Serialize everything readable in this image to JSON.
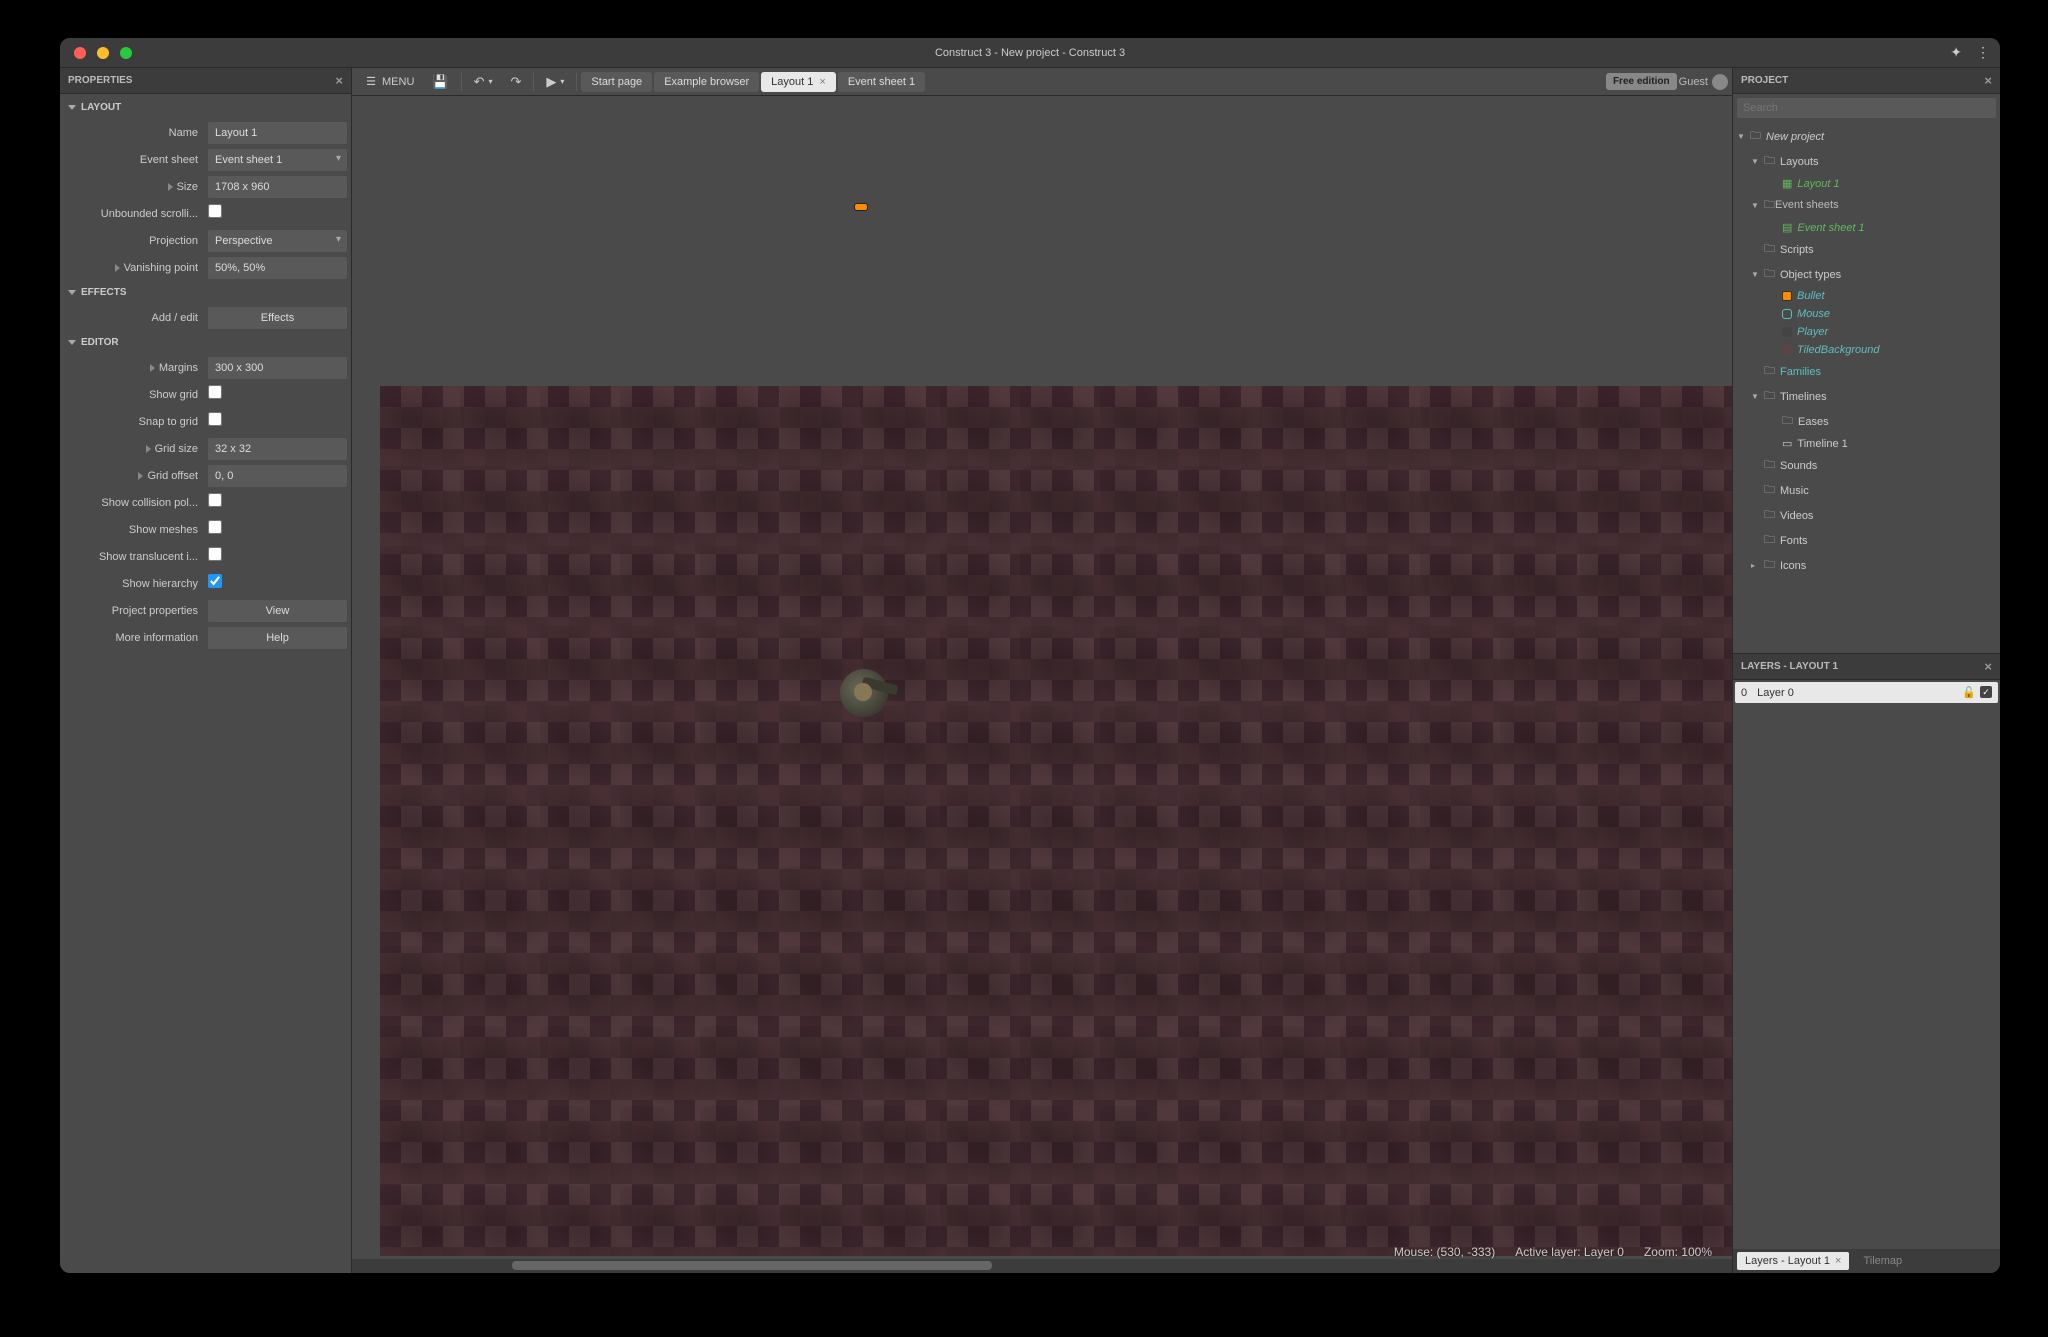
{
  "title": "Construct 3 - New project - Construct 3",
  "properties_panel": {
    "title": "PROPERTIES",
    "sections": {
      "layout": {
        "title": "LAYOUT",
        "name_label": "Name",
        "name_value": "Layout 1",
        "event_sheet_label": "Event sheet",
        "event_sheet_value": "Event sheet 1",
        "size_label": "Size",
        "size_value": "1708 x 960",
        "unbounded_label": "Unbounded scrolli...",
        "projection_label": "Projection",
        "projection_value": "Perspective",
        "vanishing_label": "Vanishing point",
        "vanishing_value": "50%, 50%"
      },
      "effects": {
        "title": "EFFECTS",
        "addedit_label": "Add / edit",
        "addedit_btn": "Effects"
      },
      "editor": {
        "title": "EDITOR",
        "margins_label": "Margins",
        "margins_value": "300 x 300",
        "show_grid_label": "Show grid",
        "snap_grid_label": "Snap to grid",
        "grid_size_label": "Grid size",
        "grid_size_value": "32 x 32",
        "grid_offset_label": "Grid offset",
        "grid_offset_value": "0, 0",
        "collision_label": "Show collision pol...",
        "meshes_label": "Show meshes",
        "translucent_label": "Show translucent i...",
        "hierarchy_label": "Show hierarchy",
        "project_props_label": "Project properties",
        "project_props_btn": "View",
        "more_info_label": "More information",
        "more_info_btn": "Help"
      }
    }
  },
  "toolbar": {
    "menu": "MENU",
    "tabs": {
      "start": "Start page",
      "example": "Example browser",
      "layout": "Layout 1",
      "event": "Event sheet 1"
    },
    "free_edition": "Free edition",
    "guest": "Guest"
  },
  "status": {
    "mouse": "Mouse: (530, -333)",
    "layer": "Active layer: Layer 0",
    "zoom": "Zoom: 100%"
  },
  "project_panel": {
    "title": "PROJECT",
    "search_placeholder": "Search",
    "tree": {
      "root": "New project",
      "layouts": "Layouts",
      "layout1": "Layout 1",
      "event_sheets": "Event sheets",
      "event_sheet1": "Event sheet 1",
      "scripts": "Scripts",
      "object_types": "Object types",
      "bullet": "Bullet",
      "mouse": "Mouse",
      "player": "Player",
      "tiledbg": "TiledBackground",
      "families": "Families",
      "timelines": "Timelines",
      "eases": "Eases",
      "timeline1": "Timeline 1",
      "sounds": "Sounds",
      "music": "Music",
      "videos": "Videos",
      "fonts": "Fonts",
      "icons": "Icons"
    }
  },
  "layers_panel": {
    "title": "LAYERS - LAYOUT 1",
    "layer0_num": "0",
    "layer0_name": "Layer 0"
  },
  "bottom_tabs": {
    "layers": "Layers - Layout 1",
    "tilemap": "Tilemap"
  }
}
